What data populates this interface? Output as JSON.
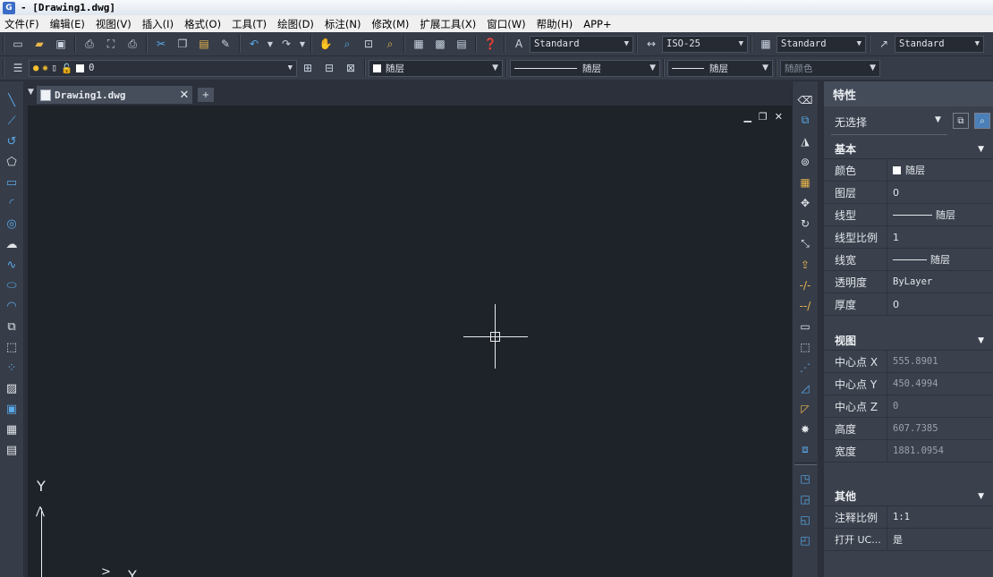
{
  "title": "- [Drawing1.dwg]",
  "menu": [
    "文件(F)",
    "编辑(E)",
    "视图(V)",
    "插入(I)",
    "格式(O)",
    "工具(T)",
    "绘图(D)",
    "标注(N)",
    "修改(M)",
    "扩展工具(X)",
    "窗口(W)",
    "帮助(H)",
    "APP+"
  ],
  "toolbar1": {
    "text_style": "Standard",
    "dim_style": "ISO-25",
    "table_style": "Standard",
    "multileader_style": "Standard"
  },
  "toolbar2": {
    "layer": "0",
    "color": "随层",
    "linetype": "随层",
    "lineweight": "随层",
    "plot_style": "随颜色"
  },
  "tab": {
    "filename": "Drawing1.dwg",
    "close": "✕",
    "dropdown": "▼"
  },
  "canvas": {
    "ucs_y": "Y",
    "ucs_x": "Y",
    "minimize": "▁",
    "restore": "❐",
    "close": "✕"
  },
  "properties": {
    "title": "特性",
    "selection": "无选择",
    "sections": {
      "basic": "基本",
      "view": "视图",
      "other": "其他"
    },
    "basic_rows": [
      {
        "name": "颜色",
        "value": "随层"
      },
      {
        "name": "图层",
        "value": "0"
      },
      {
        "name": "线型",
        "value": "随层"
      },
      {
        "name": "线型比例",
        "value": "1"
      },
      {
        "name": "线宽",
        "value": "随层"
      },
      {
        "name": "透明度",
        "value": "ByLayer"
      },
      {
        "name": "厚度",
        "value": "0"
      }
    ],
    "view_rows": [
      {
        "name": "中心点 X",
        "value": "555.8901"
      },
      {
        "name": "中心点 Y",
        "value": "450.4994"
      },
      {
        "name": "中心点 Z",
        "value": "0"
      },
      {
        "name": "高度",
        "value": "607.7385"
      },
      {
        "name": "宽度",
        "value": "1881.0954"
      }
    ],
    "other_rows": [
      {
        "name": "注释比例",
        "value": "1:1"
      },
      {
        "name": "打开 UC...",
        "value": "是"
      }
    ]
  },
  "colors": {
    "canvas": "#1e2229",
    "panel": "#3a404c",
    "toolbar": "#363c48",
    "icon_accent": "#5aa9e8"
  }
}
